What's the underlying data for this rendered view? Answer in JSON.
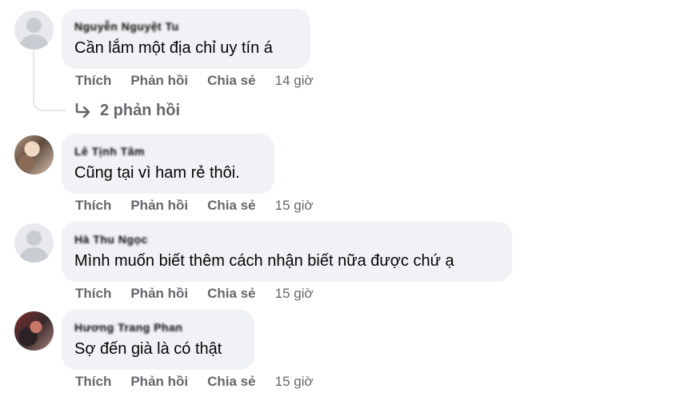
{
  "comments": [
    {
      "author": "Nguyễn Nguyệt Tu",
      "text": "Cần lắm một địa chỉ uy tín á",
      "actions": {
        "like": "Thích",
        "reply": "Phản hồi",
        "share": "Chia sẻ"
      },
      "time": "14 giờ",
      "replies_label": "2 phản hồi"
    },
    {
      "author": "Lê Tịnh Tâm",
      "text": "Cũng tại vì ham rẻ thôi.",
      "actions": {
        "like": "Thích",
        "reply": "Phản hồi",
        "share": "Chia sẻ"
      },
      "time": "15 giờ"
    },
    {
      "author": "Hà Thu Ngọc",
      "text": "Mình muốn biết thêm cách nhận biết nữa được chứ ạ",
      "actions": {
        "like": "Thích",
        "reply": "Phản hồi",
        "share": "Chia sẻ"
      },
      "time": "15 giờ"
    },
    {
      "author": "Hương Trang Phan",
      "text": "Sợ đến già là có thật",
      "actions": {
        "like": "Thích",
        "reply": "Phản hồi",
        "share": "Chia sẻ"
      },
      "time": "15 giờ"
    }
  ],
  "icons": {
    "reply_arrow": "reply-arrow-icon",
    "default_avatar": "default-avatar-icon"
  },
  "colors": {
    "bubble": "#f0f2f5",
    "secondary_text": "#65676b",
    "primary_text": "#050505"
  }
}
